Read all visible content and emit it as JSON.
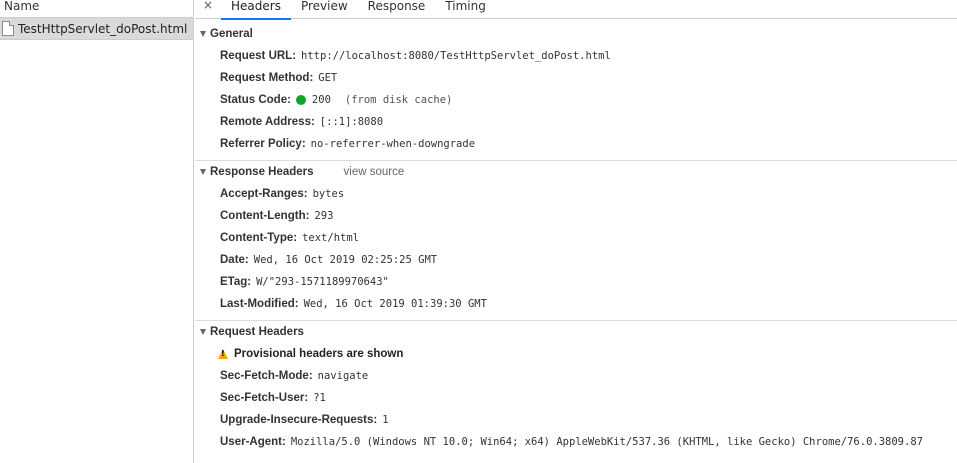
{
  "request_list": {
    "column_header": "Name",
    "items": [
      {
        "name": "TestHttpServlet_doPost.html"
      }
    ]
  },
  "tabs": {
    "close_glyph": "×",
    "items": [
      {
        "label": "Headers"
      },
      {
        "label": "Preview"
      },
      {
        "label": "Response"
      },
      {
        "label": "Timing"
      }
    ],
    "active": "Headers"
  },
  "general": {
    "title": "General",
    "request_url_key": "Request URL:",
    "request_url": "http://localhost:8080/TestHttpServlet_doPost.html",
    "request_method_key": "Request Method:",
    "request_method": "GET",
    "status_code_key": "Status Code:",
    "status_code": "200",
    "status_note": "(from disk cache)",
    "status_color": "#0fa32c",
    "remote_address_key": "Remote Address:",
    "remote_address": "[::1]:8080",
    "referrer_policy_key": "Referrer Policy:",
    "referrer_policy": "no-referrer-when-downgrade"
  },
  "response_headers": {
    "title": "Response Headers",
    "view_source": "view source",
    "items": [
      {
        "key": "Accept-Ranges:",
        "value": "bytes"
      },
      {
        "key": "Content-Length:",
        "value": "293"
      },
      {
        "key": "Content-Type:",
        "value": "text/html"
      },
      {
        "key": "Date:",
        "value": "Wed, 16 Oct 2019 02:25:25 GMT"
      },
      {
        "key": "ETag:",
        "value": "W/\"293-1571189970643\""
      },
      {
        "key": "Last-Modified:",
        "value": "Wed, 16 Oct 2019 01:39:30 GMT"
      }
    ]
  },
  "request_headers": {
    "title": "Request Headers",
    "warning": "Provisional headers are shown",
    "items": [
      {
        "key": "Sec-Fetch-Mode:",
        "value": "navigate"
      },
      {
        "key": "Sec-Fetch-User:",
        "value": "?1"
      },
      {
        "key": "Upgrade-Insecure-Requests:",
        "value": "1"
      },
      {
        "key": "User-Agent:",
        "value": "Mozilla/5.0 (Windows NT 10.0; Win64; x64) AppleWebKit/537.36 (KHTML, like Gecko) Chrome/76.0.3809.87"
      }
    ]
  }
}
